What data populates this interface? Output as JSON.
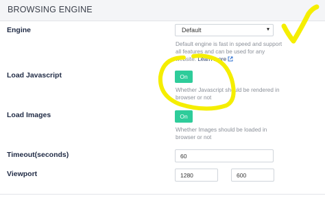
{
  "section": {
    "title": "BROWSING ENGINE"
  },
  "engine": {
    "label": "Engine",
    "selected": "Default",
    "help": "Default engine is fast in speed and support all features and can be used for any website.",
    "learn_more": "Learn more"
  },
  "load_javascript": {
    "label": "Load Javascript",
    "toggle": "On",
    "help": "Whether Javascript should be rendered in browser or not"
  },
  "load_images": {
    "label": "Load Images",
    "toggle": "On",
    "help": "Whether Images should be loaded in browser or not"
  },
  "timeout": {
    "label": "Timeout(seconds)",
    "value": "60"
  },
  "viewport": {
    "label": "Viewport",
    "width": "1280",
    "height": "600"
  },
  "colors": {
    "toggle_on": "#2ecc9a",
    "annotation": "#f5ee00"
  },
  "icons": {
    "external_link": "external-link-icon",
    "dropdown": "chevron-down-icon"
  }
}
